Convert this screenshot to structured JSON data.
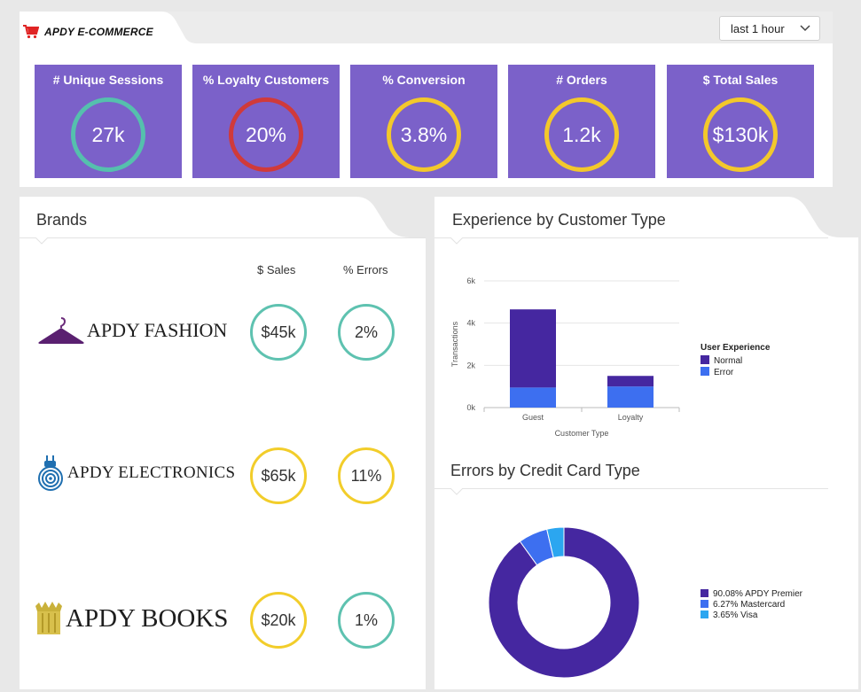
{
  "app": {
    "title": "APDY E-COMMERCE",
    "time_range": "last 1 hour"
  },
  "kpis": [
    {
      "label": "# Unique Sessions",
      "value": "27k",
      "ring_color": "#55c0ad"
    },
    {
      "label": "% Loyalty Customers",
      "value": "20%",
      "ring_color": "#d03a3a"
    },
    {
      "label": "% Conversion",
      "value": "3.8%",
      "ring_color": "#f3c82b"
    },
    {
      "label": "# Orders",
      "value": "1.2k",
      "ring_color": "#f3c82b"
    },
    {
      "label": "$ Total Sales",
      "value": "$130k",
      "ring_color": "#f3c82b"
    }
  ],
  "brands_panel": {
    "title": "Brands",
    "col_sales": "$ Sales",
    "col_errors": "% Errors",
    "rows": [
      {
        "name": "APDY FASHION",
        "logo": "hanger-icon",
        "sales": "$45k",
        "errors": "2%",
        "sales_color": "#5ec2b0",
        "errors_color": "#5ec2b0"
      },
      {
        "name": "APDY ELECTRONICS",
        "logo": "plug-target-icon",
        "sales": "$65k",
        "errors": "11%",
        "sales_color": "#f2cd2a",
        "errors_color": "#f2cd2a"
      },
      {
        "name": "APDY BOOKS",
        "logo": "books-icon",
        "sales": "$20k",
        "errors": "1%",
        "sales_color": "#f2cd2a",
        "errors_color": "#5ec2b0"
      }
    ]
  },
  "experience_panel": {
    "title": "Experience by Customer Type"
  },
  "errors_panel": {
    "title": "Errors by Credit Card Type"
  },
  "chart_data": [
    {
      "type": "bar",
      "stacked": true,
      "categories": [
        "Guest",
        "Loyalty"
      ],
      "series": [
        {
          "name": "Normal",
          "values": [
            3700,
            500
          ],
          "color": "#4527a0"
        },
        {
          "name": "Error",
          "values": [
            950,
            1000
          ],
          "color": "#3d6ff0"
        }
      ],
      "xlabel": "Customer Type",
      "ylabel": "Transactions",
      "yticks": [
        "0k",
        "2k",
        "4k",
        "6k"
      ],
      "ylim": [
        0,
        6000
      ],
      "legend_title": "User Experience",
      "legend_position": "right",
      "grid": true
    },
    {
      "type": "pie",
      "donut": true,
      "slices": [
        {
          "label": "90.08% APDY Premier",
          "value": 90.08,
          "color": "#4527a0"
        },
        {
          "label": "6.27% Mastercard",
          "value": 6.27,
          "color": "#3d6ff0"
        },
        {
          "label": "3.65% Visa",
          "value": 3.65,
          "color": "#2ba6f0"
        }
      ],
      "legend_position": "right"
    }
  ]
}
